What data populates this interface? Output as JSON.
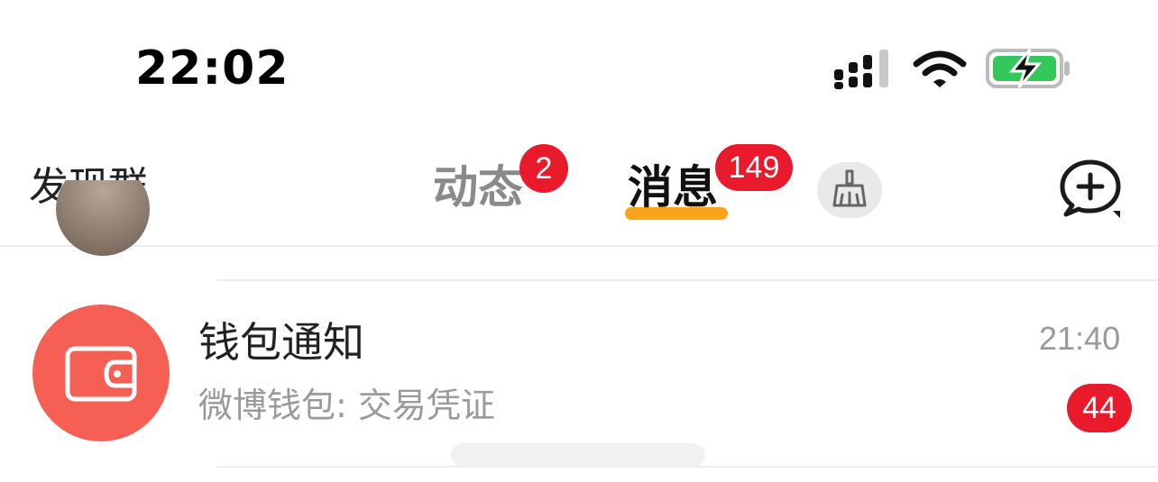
{
  "status_bar": {
    "time": "22:02",
    "icons": [
      "signal-icon",
      "wifi-icon",
      "battery-charging-icon"
    ],
    "battery_color": "#34c759"
  },
  "nav": {
    "left_label": "发现群",
    "tabs": [
      {
        "label": "动态",
        "badge": "2"
      },
      {
        "label": "消息",
        "badge": "149"
      }
    ],
    "active_tab_underline_color": "#f8a51c",
    "clear_button_icon": "broom-icon",
    "compose_button_icon": "add-chat-icon"
  },
  "list": {
    "items": [
      {
        "title": "钱包通知",
        "subtitle": "微博钱包: 交易凭证",
        "time": "21:40",
        "badge": "44",
        "avatar_icon": "wallet-icon",
        "avatar_color": "#f55f54"
      }
    ]
  },
  "colors": {
    "badge_red": "#e81a2b",
    "text_primary": "#222222",
    "text_secondary": "#9a9a9a"
  }
}
